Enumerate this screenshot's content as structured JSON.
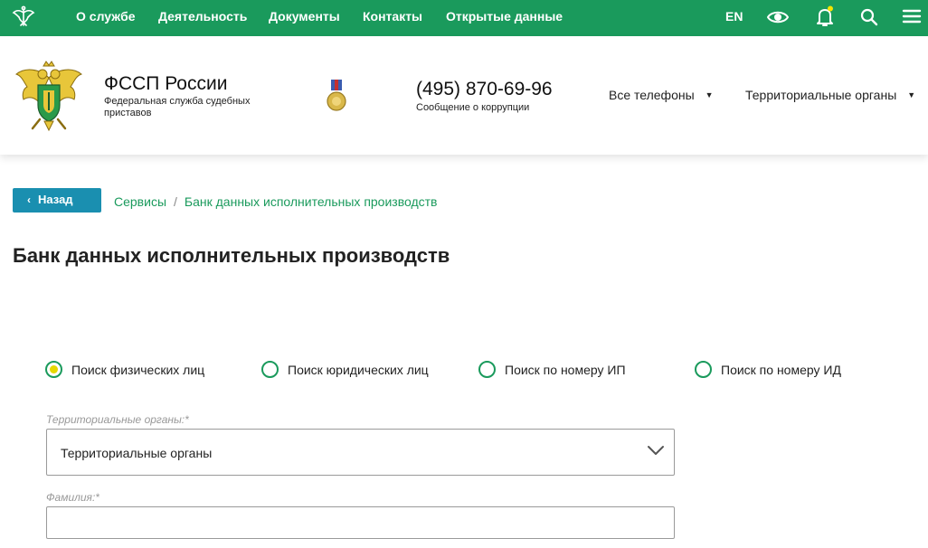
{
  "topnav": {
    "items": [
      "О службе",
      "Деятельность",
      "Документы",
      "Контакты",
      "Открытые данные"
    ],
    "lang": "EN",
    "icons": [
      "eye-icon",
      "bell-icon",
      "search-icon",
      "menu-icon"
    ],
    "notification_dot_color": "#f5e400"
  },
  "header": {
    "org_name": "ФССП России",
    "org_subtitle": "Федеральная служба судебных приставов",
    "phone": "(495) 870-69-96",
    "phone_note": "Сообщение о коррупции",
    "dropdowns": [
      "Все телефоны",
      "Территориальные органы"
    ]
  },
  "breadcrumb": {
    "back_label": "Назад",
    "items": [
      "Сервисы",
      "Банк данных исполнительных производств"
    ]
  },
  "page": {
    "title": "Банк данных исполнительных производств"
  },
  "search_modes": {
    "options": [
      "Поиск физических лиц",
      "Поиск юридических лиц",
      "Поиск по номеру ИП",
      "Поиск по номеру ИД"
    ],
    "selected_index": 0
  },
  "form": {
    "region_label": "Территориальные органы:*",
    "region_value": "Территориальные органы",
    "surname_label": "Фамилия:*",
    "surname_value": ""
  },
  "colors": {
    "brand_green": "#1a9a5c",
    "back_button": "#1a8fb0",
    "radio_selected": "#e6d800"
  }
}
